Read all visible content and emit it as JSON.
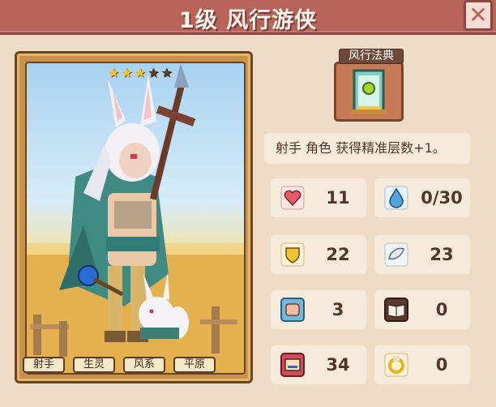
{
  "header": {
    "title": "1级 风行游侠"
  },
  "card": {
    "stars": {
      "filled": 3,
      "total": 5
    },
    "tags": [
      "射手",
      "生灵",
      "风系",
      "平原"
    ]
  },
  "relic": {
    "label": "风行法典"
  },
  "description": "射手 角色 获得精准层数+1。",
  "stats": {
    "health": "11",
    "mana": "0/30",
    "armor": "22",
    "speed": "23",
    "attack": "3",
    "book": "0",
    "block": "34",
    "gold": "0"
  },
  "colors": {
    "header": "#b8645b",
    "panel": "#efdcc6",
    "stat_bg": "#f6eadb",
    "text": "#4e3727"
  }
}
